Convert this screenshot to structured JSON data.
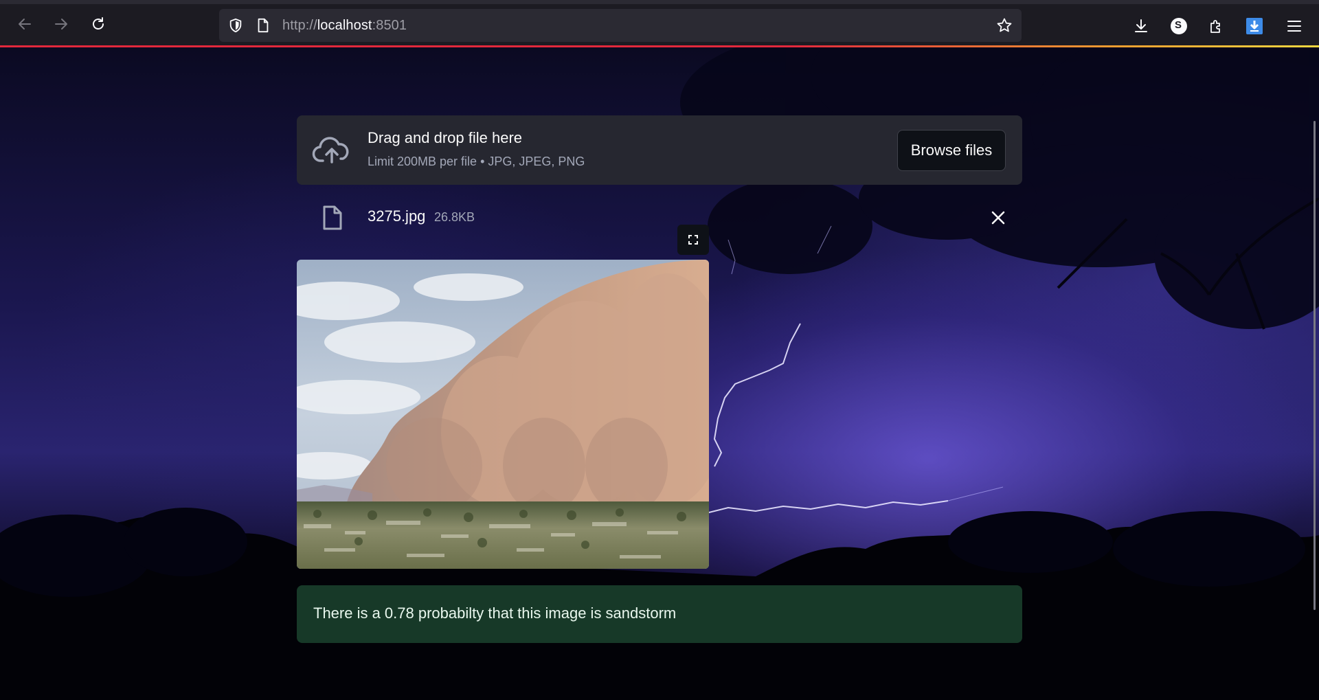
{
  "browser": {
    "url_prefix": "http://",
    "url_host": "localhost",
    "url_port": ":8501",
    "icons": {
      "back": "back-arrow-icon",
      "forward": "forward-arrow-icon",
      "reload": "reload-icon",
      "shield": "shield-icon",
      "page": "page-icon",
      "bookmark": "star-icon",
      "downloads": "download-icon",
      "account": "account-icon",
      "extensions": "puzzle-icon",
      "extension": "extension-download-icon",
      "menu": "hamburger-menu-icon"
    },
    "account_initial": "S"
  },
  "uploader": {
    "title": "Drag and drop file here",
    "hint": "Limit 200MB per file • JPG, JPEG, PNG",
    "browse_label": "Browse files"
  },
  "file": {
    "name": "3275.jpg",
    "size": "26.8KB"
  },
  "result": {
    "message": "There is a 0.78 probabilty that this image is sandstorm"
  },
  "colors": {
    "uploader_bg": "#262730",
    "success_bg": "#173928",
    "success_text": "#e9f7ee",
    "accent_line": "#e2283c"
  }
}
